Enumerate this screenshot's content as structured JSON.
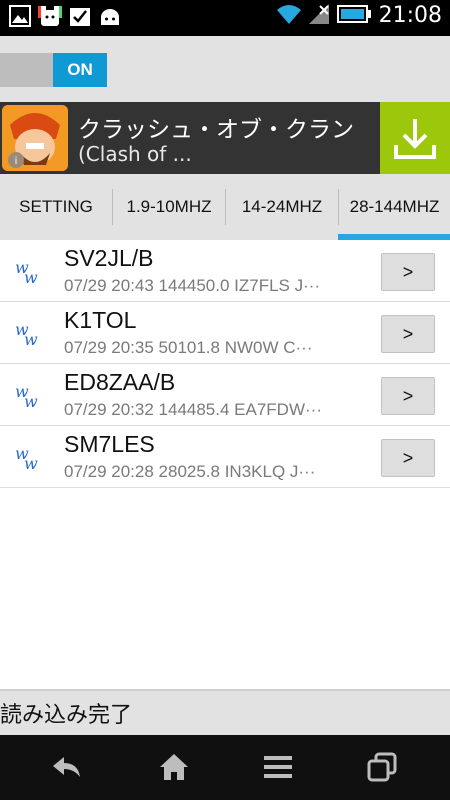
{
  "status_bar": {
    "time": "21:08",
    "icons": [
      "image-notification-icon",
      "dog-notification-icon",
      "check-notification-icon",
      "android-notification-icon",
      "wifi-icon",
      "signal-icon",
      "battery-icon"
    ]
  },
  "toggle": {
    "label": "ON",
    "state": true,
    "accent": "#0f9ad6"
  },
  "ad": {
    "title": "クラッシュ・オブ・クラン",
    "subtitle": "(Clash of ...",
    "download_color": "#9cc70a"
  },
  "tabs": [
    {
      "label": "SETTING",
      "active": false
    },
    {
      "label": "1.9-10MHZ",
      "active": false
    },
    {
      "label": "14-24MHZ",
      "active": false
    },
    {
      "label": "28-144MHZ",
      "active": true
    }
  ],
  "spots": [
    {
      "call": "SV2JL/B",
      "detail": "07/29 20:43 144450.0 IZ7FLS J···",
      "button": ">"
    },
    {
      "call": "K1TOL",
      "detail": "07/29 20:35 50101.8 NW0W C···",
      "button": ">"
    },
    {
      "call": "ED8ZAA/B",
      "detail": "07/29 20:32 144485.4 EA7FDW···",
      "button": ">"
    },
    {
      "call": "SM7LES",
      "detail": "07/29 20:28 28025.8 IN3KLQ J···",
      "button": ">"
    }
  ],
  "footer": {
    "status": "読み込み完了"
  },
  "nav": [
    "back-icon",
    "home-icon",
    "menu-icon",
    "recent-apps-icon"
  ]
}
